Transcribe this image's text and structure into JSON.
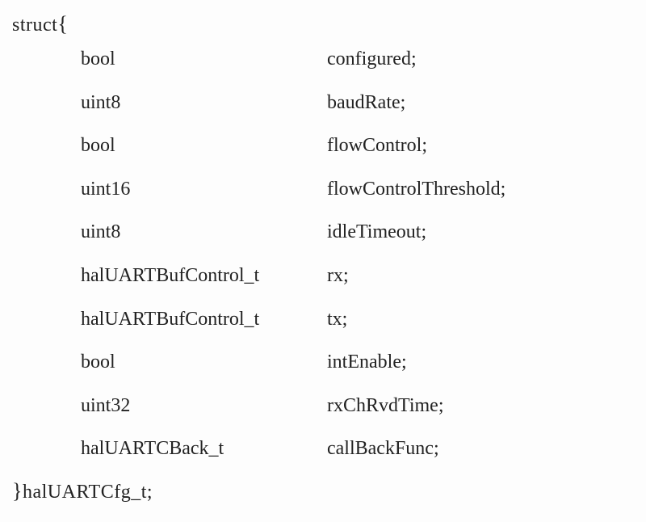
{
  "struct_keyword": "struct",
  "open_brace": "{",
  "close_brace": "}",
  "typedef_name": "halUARTCfg_t",
  "semicolon": ";",
  "members": [
    {
      "type": "bool",
      "name": "configured;"
    },
    {
      "type": "uint8",
      "name": "baudRate;"
    },
    {
      "type": "bool",
      "name": "flowControl;"
    },
    {
      "type": "uint16",
      "name": "flowControlThreshold;"
    },
    {
      "type": "uint8",
      "name": "idleTimeout;"
    },
    {
      "type": "halUARTBufControl_t",
      "name": "rx;"
    },
    {
      "type": "halUARTBufControl_t",
      "name": "tx;"
    },
    {
      "type": "bool",
      "name": "intEnable;"
    },
    {
      "type": "uint32",
      "name": "rxChRvdTime;"
    },
    {
      "type": "halUARTCBack_t",
      "name": "callBackFunc;"
    }
  ]
}
